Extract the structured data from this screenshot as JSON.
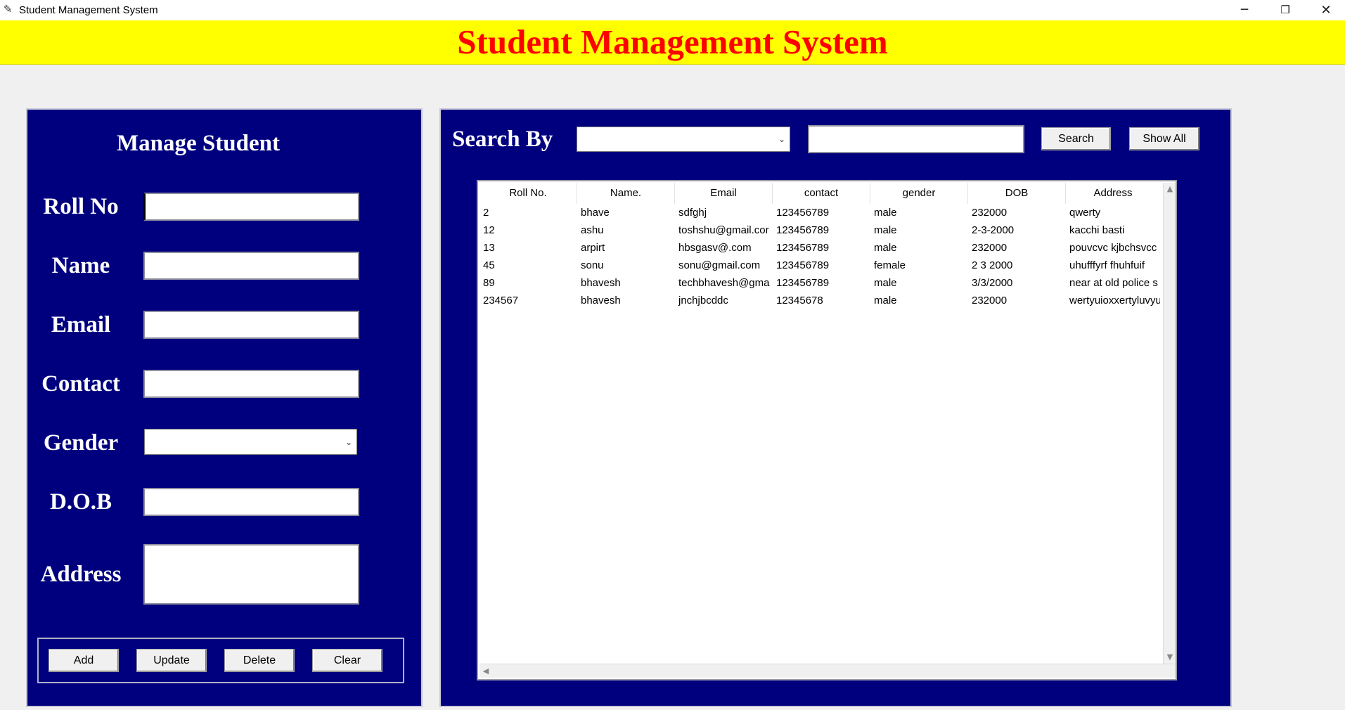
{
  "window": {
    "title": "Student Management System",
    "app_icon": "feather-icon",
    "controls": {
      "minimize": "─",
      "restore": "❐",
      "close": "✕"
    }
  },
  "banner": {
    "title": "Student Management System"
  },
  "manage": {
    "heading": "Manage Student",
    "fields": {
      "roll_no": {
        "label": "Roll No",
        "value": ""
      },
      "name": {
        "label": "Name",
        "value": ""
      },
      "email": {
        "label": "Email",
        "value": ""
      },
      "contact": {
        "label": "Contact",
        "value": ""
      },
      "gender": {
        "label": "Gender",
        "value": ""
      },
      "dob": {
        "label": "D.O.B",
        "value": ""
      },
      "address": {
        "label": "Address",
        "value": ""
      }
    },
    "buttons": {
      "add": "Add",
      "update": "Update",
      "delete": "Delete",
      "clear": "Clear"
    }
  },
  "search": {
    "label": "Search By",
    "by_value": "",
    "text_value": "",
    "search_button": "Search",
    "show_all_button": "Show All"
  },
  "table": {
    "columns": [
      "Roll No.",
      "Name.",
      "Email",
      "contact",
      "gender",
      "DOB",
      "Address"
    ],
    "rows": [
      [
        "2",
        "bhave",
        "sdfghj",
        "123456789",
        "male",
        "232000",
        "qwerty"
      ],
      [
        "12",
        "ashu",
        "toshshu@gmail.cor",
        "123456789",
        "male",
        "2-3-2000",
        "kacchi basti"
      ],
      [
        "13",
        "arpirt",
        "hbsgasv@.com",
        "123456789",
        "male",
        "232000",
        "pouvcvc kjbchsvcc"
      ],
      [
        "45",
        "sonu",
        "sonu@gmail.com",
        "123456789",
        "female",
        "2 3 2000",
        "uhufffyrf fhuhfuif"
      ],
      [
        "89",
        "bhavesh",
        "techbhavesh@gma",
        "123456789",
        "male",
        "3/3/2000",
        "near at old  police s"
      ],
      [
        "234567",
        "bhavesh",
        "jnchjbcddc",
        "12345678",
        "male",
        "232000",
        "wertyuioxxertyluvyu"
      ]
    ]
  },
  "colors": {
    "banner_bg": "#ffff00",
    "banner_text": "#ff0000",
    "panel_bg": "#00007f",
    "label_text": "#ffffff"
  }
}
